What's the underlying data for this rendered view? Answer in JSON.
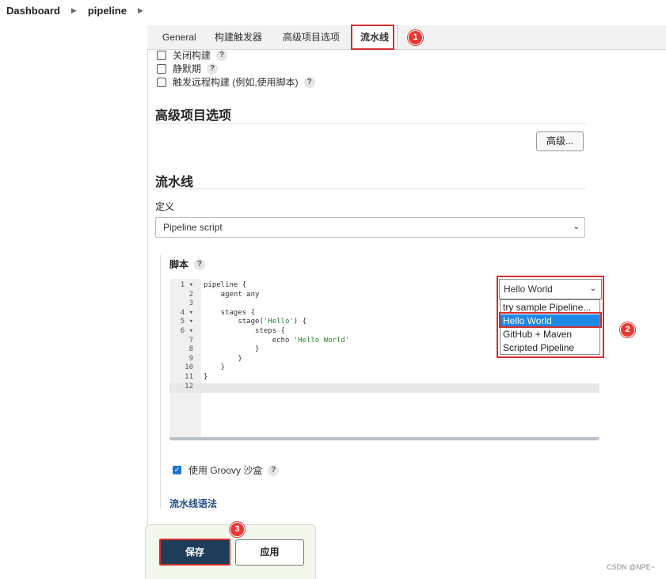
{
  "breadcrumb": [
    "Dashboard",
    "pipeline"
  ],
  "tabs": [
    "General",
    "构建触发器",
    "高级项目选项",
    "流水线"
  ],
  "active_tab": "流水线",
  "callouts": [
    "1",
    "2",
    "3"
  ],
  "triggers": [
    "关闭构建",
    "静默期",
    "触发远程构建 (例如,使用脚本)"
  ],
  "help_mark": "?",
  "sections": {
    "advanced_title": "高级项目选项",
    "advanced_button": "高级...",
    "pipeline_title": "流水线",
    "definition_label": "定义",
    "definition_value": "Pipeline script",
    "script_label": "脚本"
  },
  "editor": {
    "line_numbers": [
      "1",
      "2",
      "3",
      "4",
      "5",
      "6",
      "7",
      "8",
      "9",
      "10",
      "11",
      "12"
    ],
    "fold_marks": [
      "▾",
      "",
      "",
      "▾",
      "▾",
      "▾",
      "",
      "",
      "",
      "",
      "",
      ""
    ],
    "code": [
      "pipeline {",
      "    agent any",
      "",
      "    stages {",
      "        stage(",
      "            steps {",
      "                echo ",
      "            }",
      "        }",
      "    }",
      "}",
      ""
    ],
    "strings": [
      "'Hello'",
      "'Hello World'"
    ],
    "code_suffix": [
      ") {"
    ]
  },
  "sample": {
    "selected": "Hello World",
    "options": [
      "try sample Pipeline...",
      "Hello World",
      "GitHub + Maven",
      "Scripted Pipeline"
    ]
  },
  "groovy_sandbox_label": "使用 Groovy 沙盒",
  "syntax_link": "流水线语法",
  "buttons": {
    "save": "保存",
    "apply": "应用"
  },
  "watermark": "CSDN @NPE~",
  "colors": {
    "accent_red": "#d32f2f",
    "save_bg": "#1f3d5a",
    "selected_option": "#1e88e5"
  }
}
